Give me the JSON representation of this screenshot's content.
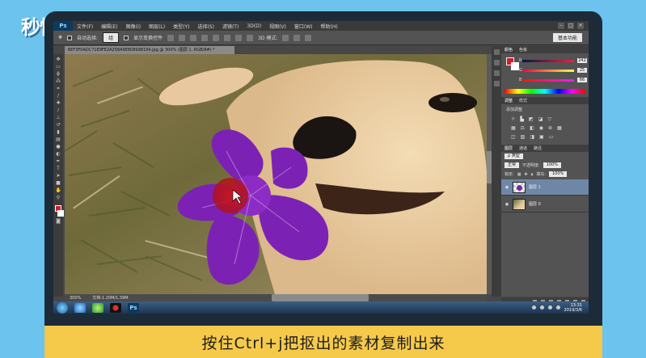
{
  "brand": {
    "logo_text": "秒懂视频"
  },
  "menu": {
    "app_icon": "Ps",
    "items": [
      "文件(F)",
      "编辑(E)",
      "图像(I)",
      "图层(L)",
      "类型(Y)",
      "选择(S)",
      "滤镜(T)",
      "3D(D)",
      "视图(V)",
      "窗口(W)",
      "帮助(H)"
    ]
  },
  "options": {
    "auto_select_label": "自动选择:",
    "auto_select_value": "组",
    "show_transform_label": "显示变换控件",
    "mode_label": "3D 模式:",
    "workspace": "基本功能"
  },
  "document": {
    "tab_title": "6EF3F0ADC71E9FE2A258A9E808998194.jpg @ 300% (图层 1, RGB/8#) *",
    "zoom": "300%",
    "doc_size": "文档:1.20M/1.39M"
  },
  "color_panel": {
    "tabs": [
      "颜色",
      "色板"
    ],
    "r": 242,
    "g": 25,
    "b": 66,
    "r_label": "R",
    "g_label": "G",
    "b_label": "B"
  },
  "adjust_panel": {
    "tabs": [
      "调整",
      "样式"
    ],
    "title": "添加调整"
  },
  "layers_panel": {
    "tabs": [
      "图层",
      "通道",
      "路径"
    ],
    "filter_label": "ρ 类型",
    "blend_mode": "正常",
    "opacity_label": "不透明度:",
    "opacity_value": "100%",
    "lock_label": "锁定:",
    "fill_label": "填充:",
    "fill_value": "100%",
    "layers": [
      {
        "name": "图层 1",
        "selected": true
      },
      {
        "name": "图层 0",
        "selected": false
      }
    ]
  },
  "taskbar": {
    "ps_button": "Ps",
    "time": "13:31",
    "date": "2019/3/6"
  },
  "caption": {
    "text": "按住Ctrl+j把抠出的素材复制出来"
  },
  "colors": {
    "background": "#6cc3ee",
    "frame": "#1d2b39",
    "caption_bg": "#f5c94a",
    "foreground_swatch": "#d61a2a",
    "selected_layer": "#6e87a6"
  }
}
